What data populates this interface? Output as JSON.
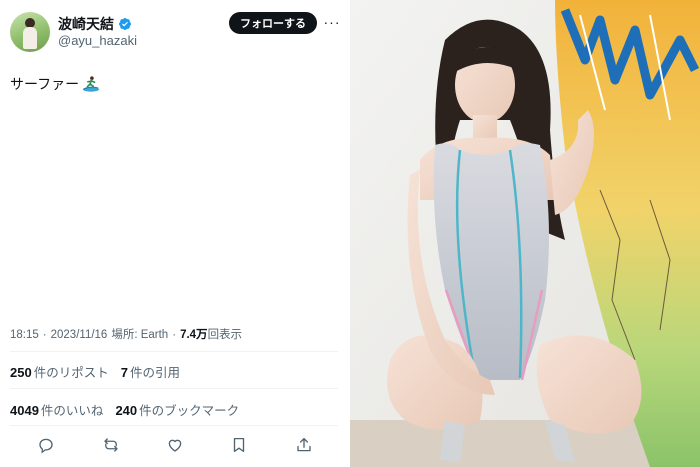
{
  "author": {
    "display_name": "波崎天結",
    "handle": "@ayu_hazaki",
    "follow_label": "フォローする",
    "more_label": "···"
  },
  "tweet": {
    "text": "サーファー",
    "emoji": "surfer-emoji"
  },
  "meta": {
    "time": "18:15",
    "separator": "·",
    "date": "2023/11/16",
    "location": "場所: Earth",
    "separator2": "·",
    "views_count": "7.4万",
    "views_label": "回表示"
  },
  "stats": {
    "reposts_count": "250",
    "reposts_label": "件のリポスト",
    "quotes_count": "7",
    "quotes_label": "件の引用",
    "likes_count": "4049",
    "likes_label": "件のいいね",
    "bookmarks_count": "240",
    "bookmarks_label": "件のブックマーク"
  },
  "actions": [
    "reply-icon",
    "repost-icon",
    "like-icon",
    "bookmark-icon",
    "share-icon"
  ],
  "colors": {
    "accent": "#1d9bf0",
    "text_primary": "#0f1419",
    "text_secondary": "#536471",
    "divider": "#eff3f4",
    "follow_bg": "#0f1419"
  }
}
